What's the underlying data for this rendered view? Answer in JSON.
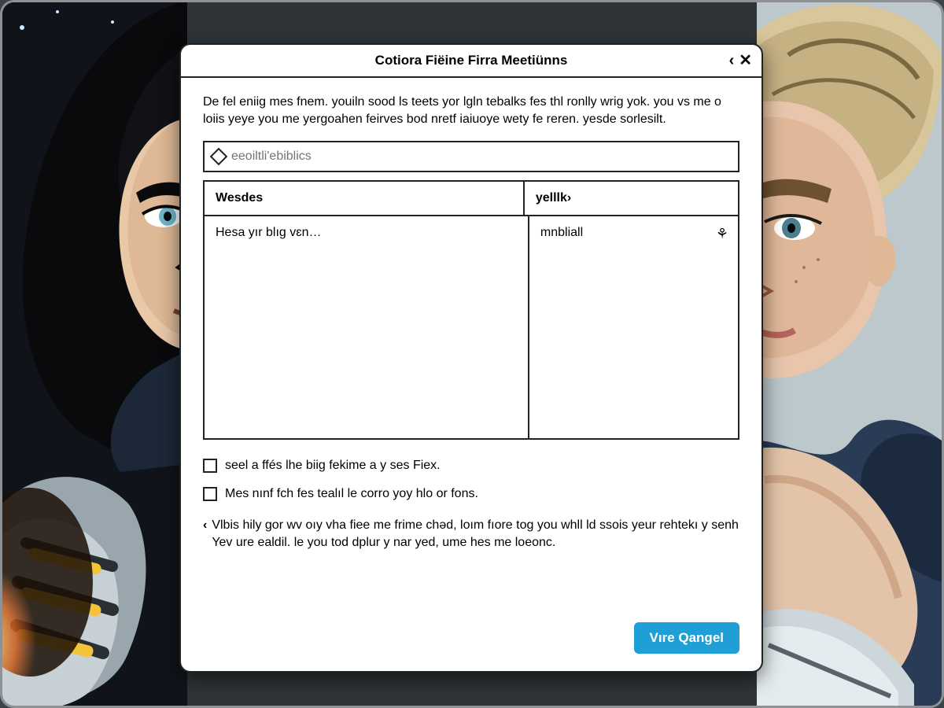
{
  "dialog": {
    "title": "Cotiora Fiëine Firra Meetiünns",
    "intro": "De fel eniig mes fnem. youiln sood ls teets yor lgln tebalks fes thl ronlly wrig yok. you vs me o loiis yeye you me yergoahen feirves bod nretf iaiuoye wety fe reren. yesde sorlesilt.",
    "search": {
      "placeholder": "eeoiltli'ebiblics",
      "value": ""
    },
    "table": {
      "col_a_header": "Wesdes",
      "col_b_header": "yelllk",
      "rows": [
        {
          "a": "Hesa yır blıg vɛn…",
          "b": "mnbliall"
        }
      ]
    },
    "checkbox1_label": "seel a ffés lhe biig fekime a y ses Fiex.",
    "checkbox2_label": "Mes nınf fch fes tealıl le corro yoy hlo or fons.",
    "footer_note": "Vlbis hily gor wv oıy vha fiee me frime chəd, loım fıore tog you whll ld ssois yeur rehtekı y senh Yev ure ealdil. le you tod dplur y nar yed, ume hes me loeonc.",
    "primary_button": "Vıre Qangel"
  }
}
